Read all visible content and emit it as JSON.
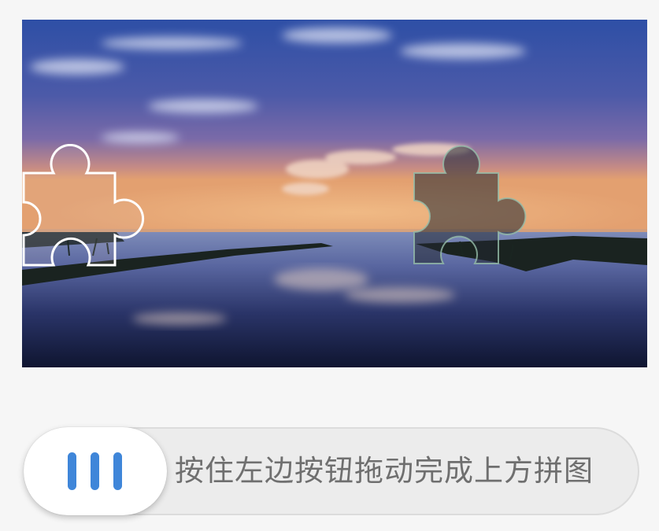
{
  "captcha": {
    "image_description_icon": "landscape-sunset-lake",
    "piece_icon": "puzzle-piece-icon",
    "slot_icon": "puzzle-slot-icon"
  },
  "slider": {
    "hint": "按住左边按钮拖动完成上方拼图",
    "handle_icon": "grip-lines-icon",
    "progress": 0,
    "accent_color": "#3f86d9"
  }
}
